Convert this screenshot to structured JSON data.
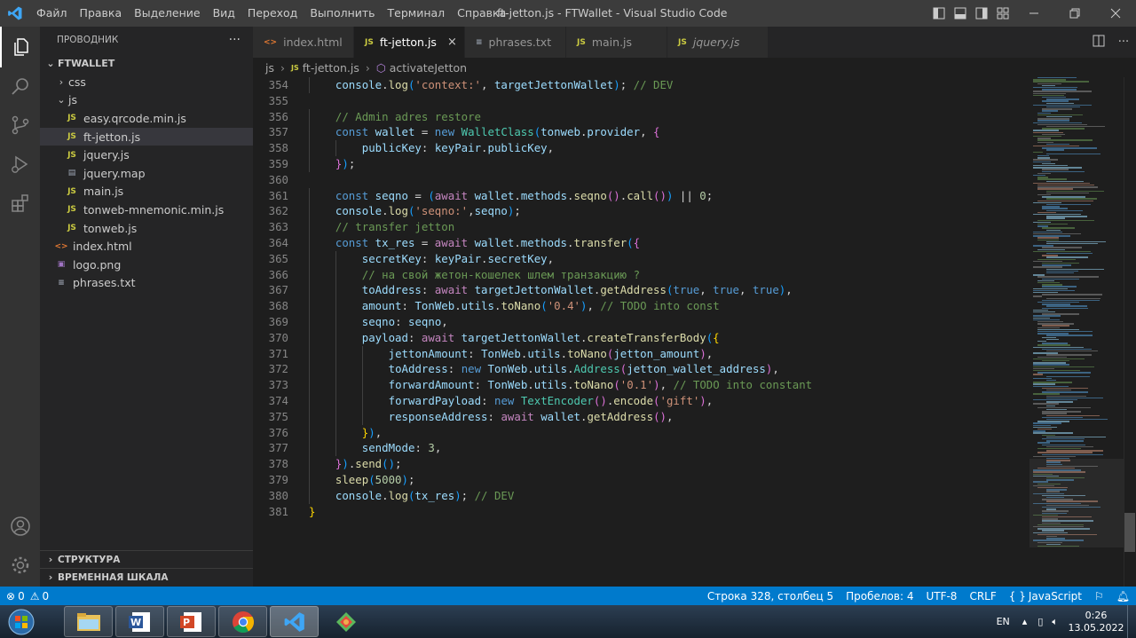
{
  "titlebar": {
    "menu": [
      "Файл",
      "Правка",
      "Выделение",
      "Вид",
      "Переход",
      "Выполнить",
      "Терминал",
      "Справка"
    ],
    "title": "ft-jetton.js - FTWallet - Visual Studio Code"
  },
  "sidebar": {
    "header": "ПРОВОДНИК",
    "more": "···",
    "root": "FTWALLET",
    "items": [
      {
        "label": "css",
        "type": "folder",
        "open": false,
        "depth": 1
      },
      {
        "label": "js",
        "type": "folder",
        "open": true,
        "depth": 1
      },
      {
        "label": "easy.qrcode.min.js",
        "type": "js",
        "depth": 2
      },
      {
        "label": "ft-jetton.js",
        "type": "js",
        "depth": 2,
        "selected": true
      },
      {
        "label": "jquery.js",
        "type": "js",
        "depth": 2
      },
      {
        "label": "jquery.map",
        "type": "map",
        "depth": 2
      },
      {
        "label": "main.js",
        "type": "js",
        "depth": 2
      },
      {
        "label": "tonweb-mnemonic.min.js",
        "type": "js",
        "depth": 2
      },
      {
        "label": "tonweb.js",
        "type": "js",
        "depth": 2
      },
      {
        "label": "index.html",
        "type": "html",
        "depth": 1
      },
      {
        "label": "logo.png",
        "type": "image",
        "depth": 1
      },
      {
        "label": "phrases.txt",
        "type": "text",
        "depth": 1
      }
    ],
    "outline": "СТРУКТУРА",
    "timeline": "ВРЕМЕННАЯ ШКАЛА"
  },
  "tabs": [
    {
      "label": "index.html",
      "icon": "html",
      "active": false
    },
    {
      "label": "ft-jetton.js",
      "icon": "js",
      "active": true,
      "close": "×"
    },
    {
      "label": "phrases.txt",
      "icon": "text",
      "active": false
    },
    {
      "label": "main.js",
      "icon": "js",
      "active": false
    },
    {
      "label": "jquery.js",
      "icon": "js",
      "active": false,
      "italic": true
    }
  ],
  "breadcrumb": {
    "folder": "js",
    "file": "ft-jetton.js",
    "symbol": "activateJetton"
  },
  "code": [
    {
      "n": "354",
      "indent": 1,
      "toks": [
        [
          "v",
          "console"
        ],
        [
          "p",
          "."
        ],
        [
          "f",
          "log"
        ],
        [
          "b3",
          "("
        ],
        [
          "s",
          "'context:'"
        ],
        [
          "p",
          ", "
        ],
        [
          "v",
          "targetJettonWallet"
        ],
        [
          "b3",
          ")"
        ],
        [
          "p",
          "; "
        ],
        [
          "c",
          "// DEV"
        ]
      ]
    },
    {
      "n": "355",
      "indent": 0,
      "toks": []
    },
    {
      "n": "356",
      "indent": 1,
      "toks": [
        [
          "c",
          "// Admin adres restore"
        ]
      ]
    },
    {
      "n": "357",
      "indent": 1,
      "toks": [
        [
          "k",
          "const "
        ],
        [
          "v",
          "wallet"
        ],
        [
          "p",
          " = "
        ],
        [
          "k",
          "new "
        ],
        [
          "t",
          "WalletClass"
        ],
        [
          "b3",
          "("
        ],
        [
          "v",
          "tonweb"
        ],
        [
          "p",
          "."
        ],
        [
          "v",
          "provider"
        ],
        [
          "p",
          ", "
        ],
        [
          "b2",
          "{"
        ]
      ]
    },
    {
      "n": "358",
      "indent": 2,
      "toks": [
        [
          "v",
          "publicKey"
        ],
        [
          "p",
          ": "
        ],
        [
          "v",
          "keyPair"
        ],
        [
          "p",
          "."
        ],
        [
          "v",
          "publicKey"
        ],
        [
          "p",
          ","
        ]
      ]
    },
    {
      "n": "359",
      "indent": 1,
      "toks": [
        [
          "b2",
          "}"
        ],
        [
          "b3",
          ")"
        ],
        [
          "p",
          ";"
        ]
      ]
    },
    {
      "n": "360",
      "indent": 0,
      "toks": []
    },
    {
      "n": "361",
      "indent": 1,
      "toks": [
        [
          "k",
          "const "
        ],
        [
          "v",
          "seqno"
        ],
        [
          "p",
          " = "
        ],
        [
          "b3",
          "("
        ],
        [
          "kc",
          "await "
        ],
        [
          "v",
          "wallet"
        ],
        [
          "p",
          "."
        ],
        [
          "v",
          "methods"
        ],
        [
          "p",
          "."
        ],
        [
          "f",
          "seqno"
        ],
        [
          "b2",
          "()"
        ],
        [
          "p",
          "."
        ],
        [
          "f",
          "call"
        ],
        [
          "b2",
          "()"
        ],
        [
          "b3",
          ")"
        ],
        [
          "p",
          " || "
        ],
        [
          "n",
          "0"
        ],
        [
          "p",
          ";"
        ]
      ]
    },
    {
      "n": "362",
      "indent": 1,
      "toks": [
        [
          "v",
          "console"
        ],
        [
          "p",
          "."
        ],
        [
          "f",
          "log"
        ],
        [
          "b3",
          "("
        ],
        [
          "s",
          "'seqno:'"
        ],
        [
          "p",
          ","
        ],
        [
          "v",
          "seqno"
        ],
        [
          "b3",
          ")"
        ],
        [
          "p",
          ";"
        ]
      ]
    },
    {
      "n": "363",
      "indent": 1,
      "toks": [
        [
          "c",
          "// transfer jetton"
        ]
      ]
    },
    {
      "n": "364",
      "indent": 1,
      "toks": [
        [
          "k",
          "const "
        ],
        [
          "v",
          "tx_res"
        ],
        [
          "p",
          " = "
        ],
        [
          "kc",
          "await "
        ],
        [
          "v",
          "wallet"
        ],
        [
          "p",
          "."
        ],
        [
          "v",
          "methods"
        ],
        [
          "p",
          "."
        ],
        [
          "f",
          "transfer"
        ],
        [
          "b3",
          "("
        ],
        [
          "b2",
          "{"
        ]
      ]
    },
    {
      "n": "365",
      "indent": 2,
      "toks": [
        [
          "v",
          "secretKey"
        ],
        [
          "p",
          ": "
        ],
        [
          "v",
          "keyPair"
        ],
        [
          "p",
          "."
        ],
        [
          "v",
          "secretKey"
        ],
        [
          "p",
          ","
        ]
      ]
    },
    {
      "n": "366",
      "indent": 2,
      "toks": [
        [
          "c",
          "// на свой жетон-кошелек шлем транзакцию ?"
        ]
      ]
    },
    {
      "n": "367",
      "indent": 2,
      "toks": [
        [
          "v",
          "toAddress"
        ],
        [
          "p",
          ": "
        ],
        [
          "kc",
          "await "
        ],
        [
          "v",
          "targetJettonWallet"
        ],
        [
          "p",
          "."
        ],
        [
          "f",
          "getAddress"
        ],
        [
          "b3",
          "("
        ],
        [
          "k",
          "true"
        ],
        [
          "p",
          ", "
        ],
        [
          "k",
          "true"
        ],
        [
          "p",
          ", "
        ],
        [
          "k",
          "true"
        ],
        [
          "b3",
          ")"
        ],
        [
          "p",
          ","
        ]
      ]
    },
    {
      "n": "368",
      "indent": 2,
      "toks": [
        [
          "v",
          "amount"
        ],
        [
          "p",
          ": "
        ],
        [
          "v",
          "TonWeb"
        ],
        [
          "p",
          "."
        ],
        [
          "v",
          "utils"
        ],
        [
          "p",
          "."
        ],
        [
          "f",
          "toNano"
        ],
        [
          "b3",
          "("
        ],
        [
          "s",
          "'0.4'"
        ],
        [
          "b3",
          ")"
        ],
        [
          "p",
          ", "
        ],
        [
          "c",
          "// TODO into const"
        ]
      ]
    },
    {
      "n": "369",
      "indent": 2,
      "toks": [
        [
          "v",
          "seqno"
        ],
        [
          "p",
          ": "
        ],
        [
          "v",
          "seqno"
        ],
        [
          "p",
          ","
        ]
      ]
    },
    {
      "n": "370",
      "indent": 2,
      "toks": [
        [
          "v",
          "payload"
        ],
        [
          "p",
          ": "
        ],
        [
          "kc",
          "await "
        ],
        [
          "v",
          "targetJettonWallet"
        ],
        [
          "p",
          "."
        ],
        [
          "f",
          "createTransferBody"
        ],
        [
          "b3",
          "("
        ],
        [
          "b1",
          "{"
        ]
      ]
    },
    {
      "n": "371",
      "indent": 3,
      "toks": [
        [
          "v",
          "jettonAmount"
        ],
        [
          "p",
          ": "
        ],
        [
          "v",
          "TonWeb"
        ],
        [
          "p",
          "."
        ],
        [
          "v",
          "utils"
        ],
        [
          "p",
          "."
        ],
        [
          "f",
          "toNano"
        ],
        [
          "b2",
          "("
        ],
        [
          "v",
          "jetton_amount"
        ],
        [
          "b2",
          ")"
        ],
        [
          "p",
          ","
        ]
      ]
    },
    {
      "n": "372",
      "indent": 3,
      "toks": [
        [
          "v",
          "toAddress"
        ],
        [
          "p",
          ": "
        ],
        [
          "k",
          "new "
        ],
        [
          "v",
          "TonWeb"
        ],
        [
          "p",
          "."
        ],
        [
          "v",
          "utils"
        ],
        [
          "p",
          "."
        ],
        [
          "t",
          "Address"
        ],
        [
          "b2",
          "("
        ],
        [
          "v",
          "jetton_wallet_address"
        ],
        [
          "b2",
          ")"
        ],
        [
          "p",
          ","
        ]
      ]
    },
    {
      "n": "373",
      "indent": 3,
      "toks": [
        [
          "v",
          "forwardAmount"
        ],
        [
          "p",
          ": "
        ],
        [
          "v",
          "TonWeb"
        ],
        [
          "p",
          "."
        ],
        [
          "v",
          "utils"
        ],
        [
          "p",
          "."
        ],
        [
          "f",
          "toNano"
        ],
        [
          "b2",
          "("
        ],
        [
          "s",
          "'0.1'"
        ],
        [
          "b2",
          ")"
        ],
        [
          "p",
          ", "
        ],
        [
          "c",
          "// TODO into constant"
        ]
      ]
    },
    {
      "n": "374",
      "indent": 3,
      "toks": [
        [
          "v",
          "forwardPayload"
        ],
        [
          "p",
          ": "
        ],
        [
          "k",
          "new "
        ],
        [
          "t",
          "TextEncoder"
        ],
        [
          "b2",
          "()"
        ],
        [
          "p",
          "."
        ],
        [
          "f",
          "encode"
        ],
        [
          "b2",
          "("
        ],
        [
          "s",
          "'gift'"
        ],
        [
          "b2",
          ")"
        ],
        [
          "p",
          ","
        ]
      ]
    },
    {
      "n": "375",
      "indent": 3,
      "toks": [
        [
          "v",
          "responseAddress"
        ],
        [
          "p",
          ": "
        ],
        [
          "kc",
          "await "
        ],
        [
          "v",
          "wallet"
        ],
        [
          "p",
          "."
        ],
        [
          "f",
          "getAddress"
        ],
        [
          "b2",
          "()"
        ],
        [
          "p",
          ","
        ]
      ]
    },
    {
      "n": "376",
      "indent": 2,
      "toks": [
        [
          "b1",
          "}"
        ],
        [
          "b3",
          ")"
        ],
        [
          "p",
          ","
        ]
      ]
    },
    {
      "n": "377",
      "indent": 2,
      "toks": [
        [
          "v",
          "sendMode"
        ],
        [
          "p",
          ": "
        ],
        [
          "n",
          "3"
        ],
        [
          "p",
          ","
        ]
      ]
    },
    {
      "n": "378",
      "indent": 1,
      "toks": [
        [
          "b2",
          "}"
        ],
        [
          "b3",
          ")"
        ],
        [
          "p",
          "."
        ],
        [
          "f",
          "send"
        ],
        [
          "b3",
          "()"
        ],
        [
          "p",
          ";"
        ]
      ]
    },
    {
      "n": "379",
      "indent": 1,
      "toks": [
        [
          "f",
          "sleep"
        ],
        [
          "b3",
          "("
        ],
        [
          "n",
          "5000"
        ],
        [
          "b3",
          ")"
        ],
        [
          "p",
          ";"
        ]
      ]
    },
    {
      "n": "380",
      "indent": 1,
      "toks": [
        [
          "v",
          "console"
        ],
        [
          "p",
          "."
        ],
        [
          "f",
          "log"
        ],
        [
          "b3",
          "("
        ],
        [
          "v",
          "tx_res"
        ],
        [
          "b3",
          ")"
        ],
        [
          "p",
          "; "
        ],
        [
          "c",
          "// DEV"
        ]
      ]
    },
    {
      "n": "381",
      "indent": 0,
      "toks": [
        [
          "b1",
          "}"
        ]
      ]
    }
  ],
  "statusbar": {
    "errors": "0",
    "warnings": "0",
    "position": "Строка 328, столбец 5",
    "spaces": "Пробелов: 4",
    "encoding": "UTF-8",
    "eol": "CRLF",
    "language": "JavaScript"
  },
  "taskbar": {
    "lang": "EN",
    "time": "0:26",
    "date": "13.05.2022"
  },
  "colors": {
    "accent": "#007acc",
    "titlebar": "#3c3c3c",
    "sidebar": "#252526",
    "editor": "#1e1e1e"
  }
}
